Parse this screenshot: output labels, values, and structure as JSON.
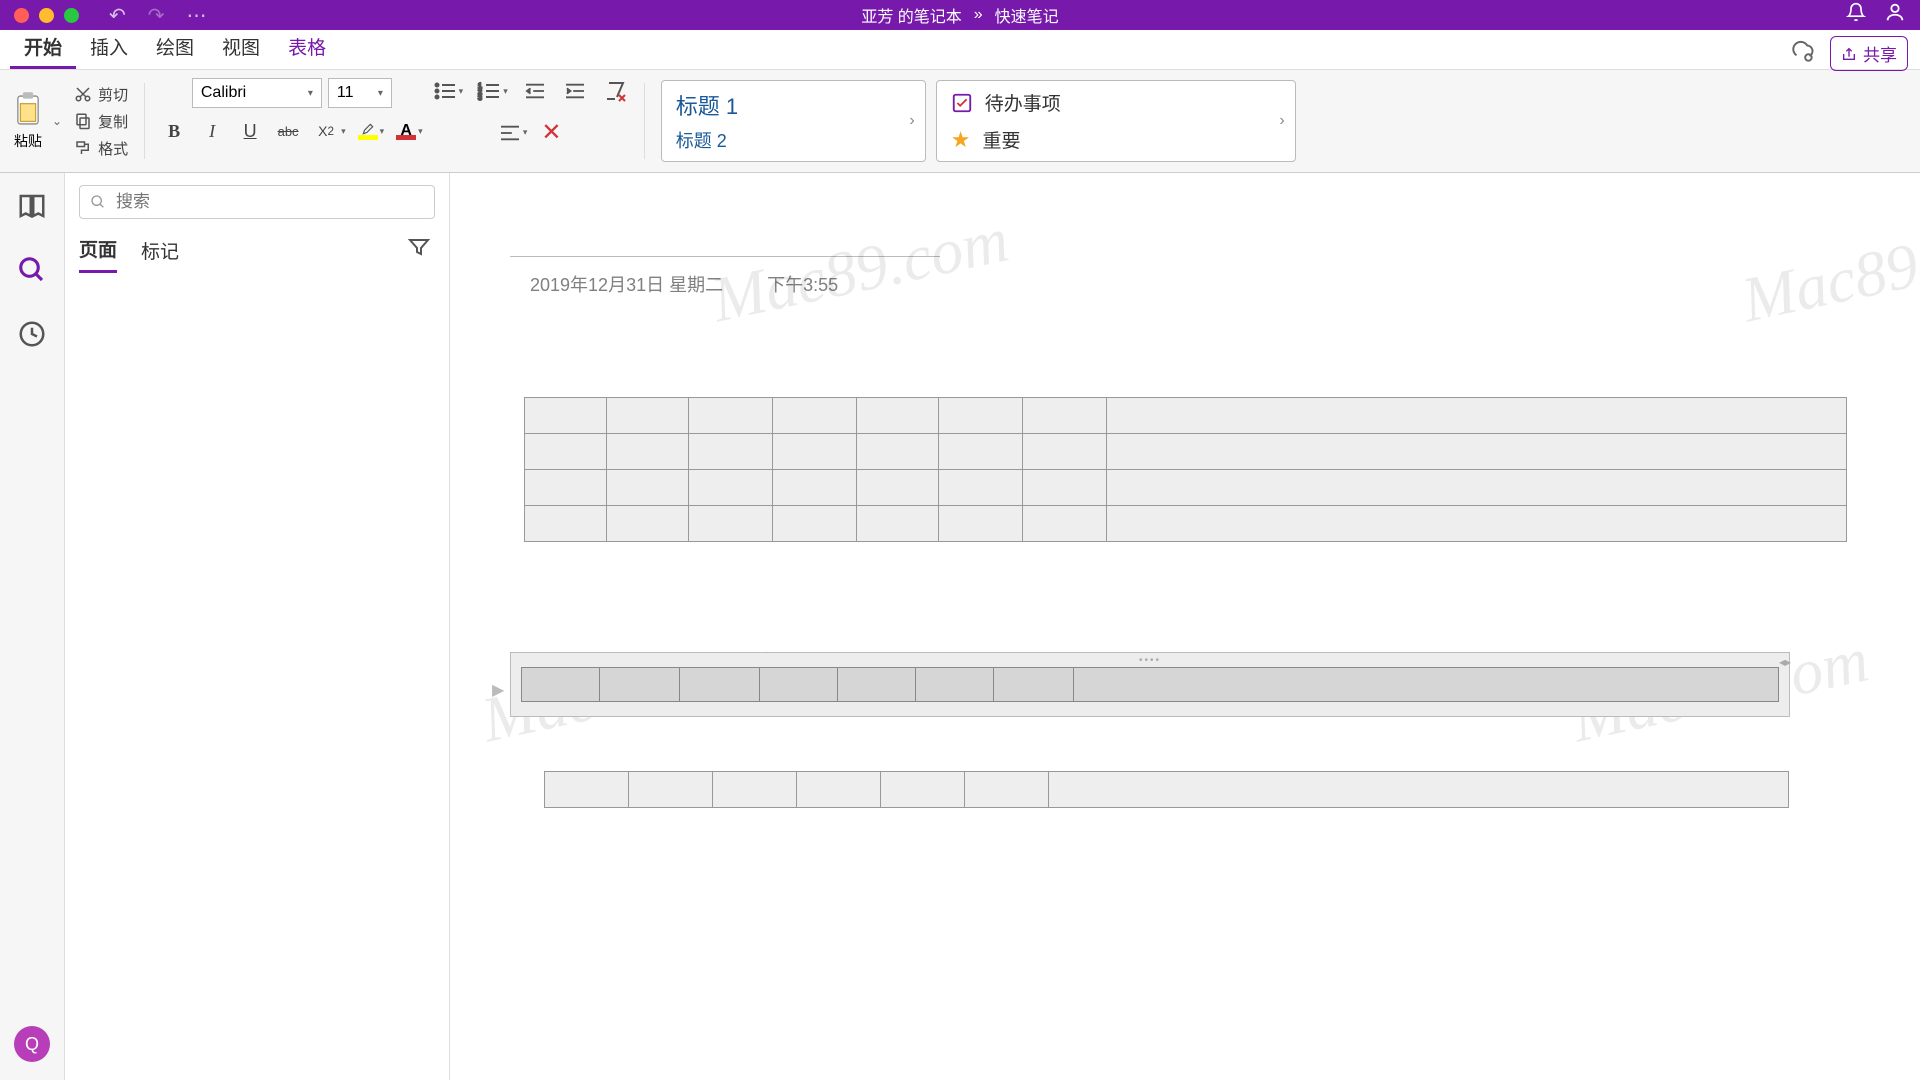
{
  "titlebar": {
    "notebook": "亚芳 的笔记本",
    "separator": "»",
    "section": "快速笔记"
  },
  "menu": {
    "tabs": [
      "开始",
      "插入",
      "绘图",
      "视图",
      "表格"
    ],
    "share": "共享"
  },
  "ribbon": {
    "paste": "粘贴",
    "cut": "剪切",
    "copy": "复制",
    "format": "格式",
    "font_name": "Calibri",
    "font_size": "11",
    "heading1": "标题 1",
    "heading2": "标题 2",
    "todo": "待办事项",
    "important": "重要"
  },
  "nav": {
    "search_placeholder": "搜索",
    "tab_pages": "页面",
    "tab_tags": "标记"
  },
  "page": {
    "date": "2019年12月31日 星期二",
    "time": "下午3:55"
  },
  "avatar": "Q",
  "watermark": "Mac89.com"
}
